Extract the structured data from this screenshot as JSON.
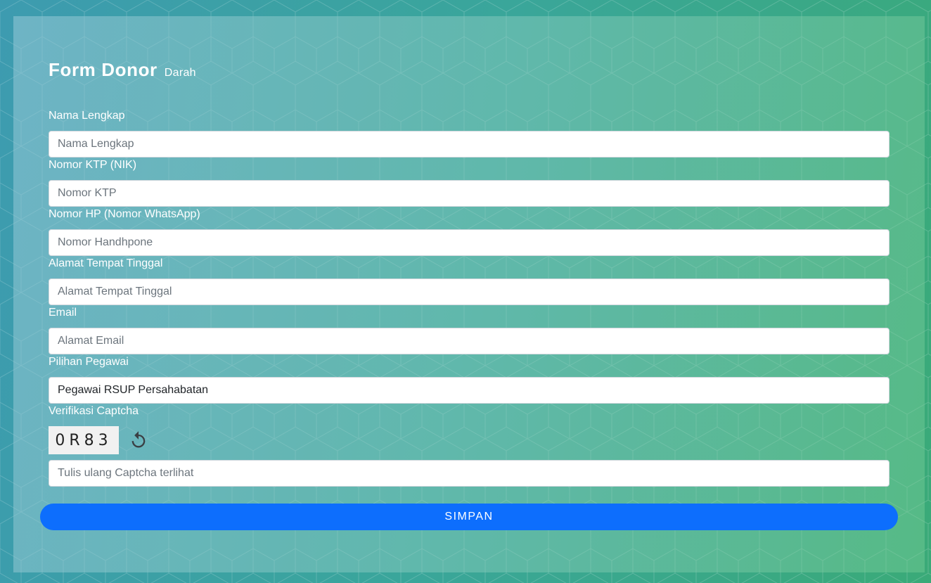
{
  "header": {
    "title": "Form Donor",
    "subtitle": "Darah"
  },
  "fields": [
    {
      "label": "Nama Lengkap",
      "placeholder": "Nama Lengkap",
      "value": ""
    },
    {
      "label": "Nomor KTP (NIK)",
      "placeholder": "Nomor KTP",
      "value": ""
    },
    {
      "label": "Nomor HP (Nomor WhatsApp)",
      "placeholder": "Nomor Handhpone",
      "value": ""
    },
    {
      "label": "Alamat Tempat Tinggal",
      "placeholder": "Alamat Tempat Tinggal",
      "value": ""
    },
    {
      "label": "Email",
      "placeholder": "Alamat Email",
      "value": ""
    }
  ],
  "employee_select": {
    "label": "Pilihan Pegawai",
    "selected": "Pegawai RSUP Persahabatan"
  },
  "captcha": {
    "label": "Verifikasi Captcha",
    "code": "0R83",
    "refresh_icon": "refresh-icon",
    "placeholder": "Tulis ulang Captcha terlihat"
  },
  "actions": {
    "save_label": "SIMPAN"
  },
  "colors": {
    "background_start": "#3d9bb0",
    "background_end": "#3aaa78",
    "button": "#0d6efd"
  }
}
